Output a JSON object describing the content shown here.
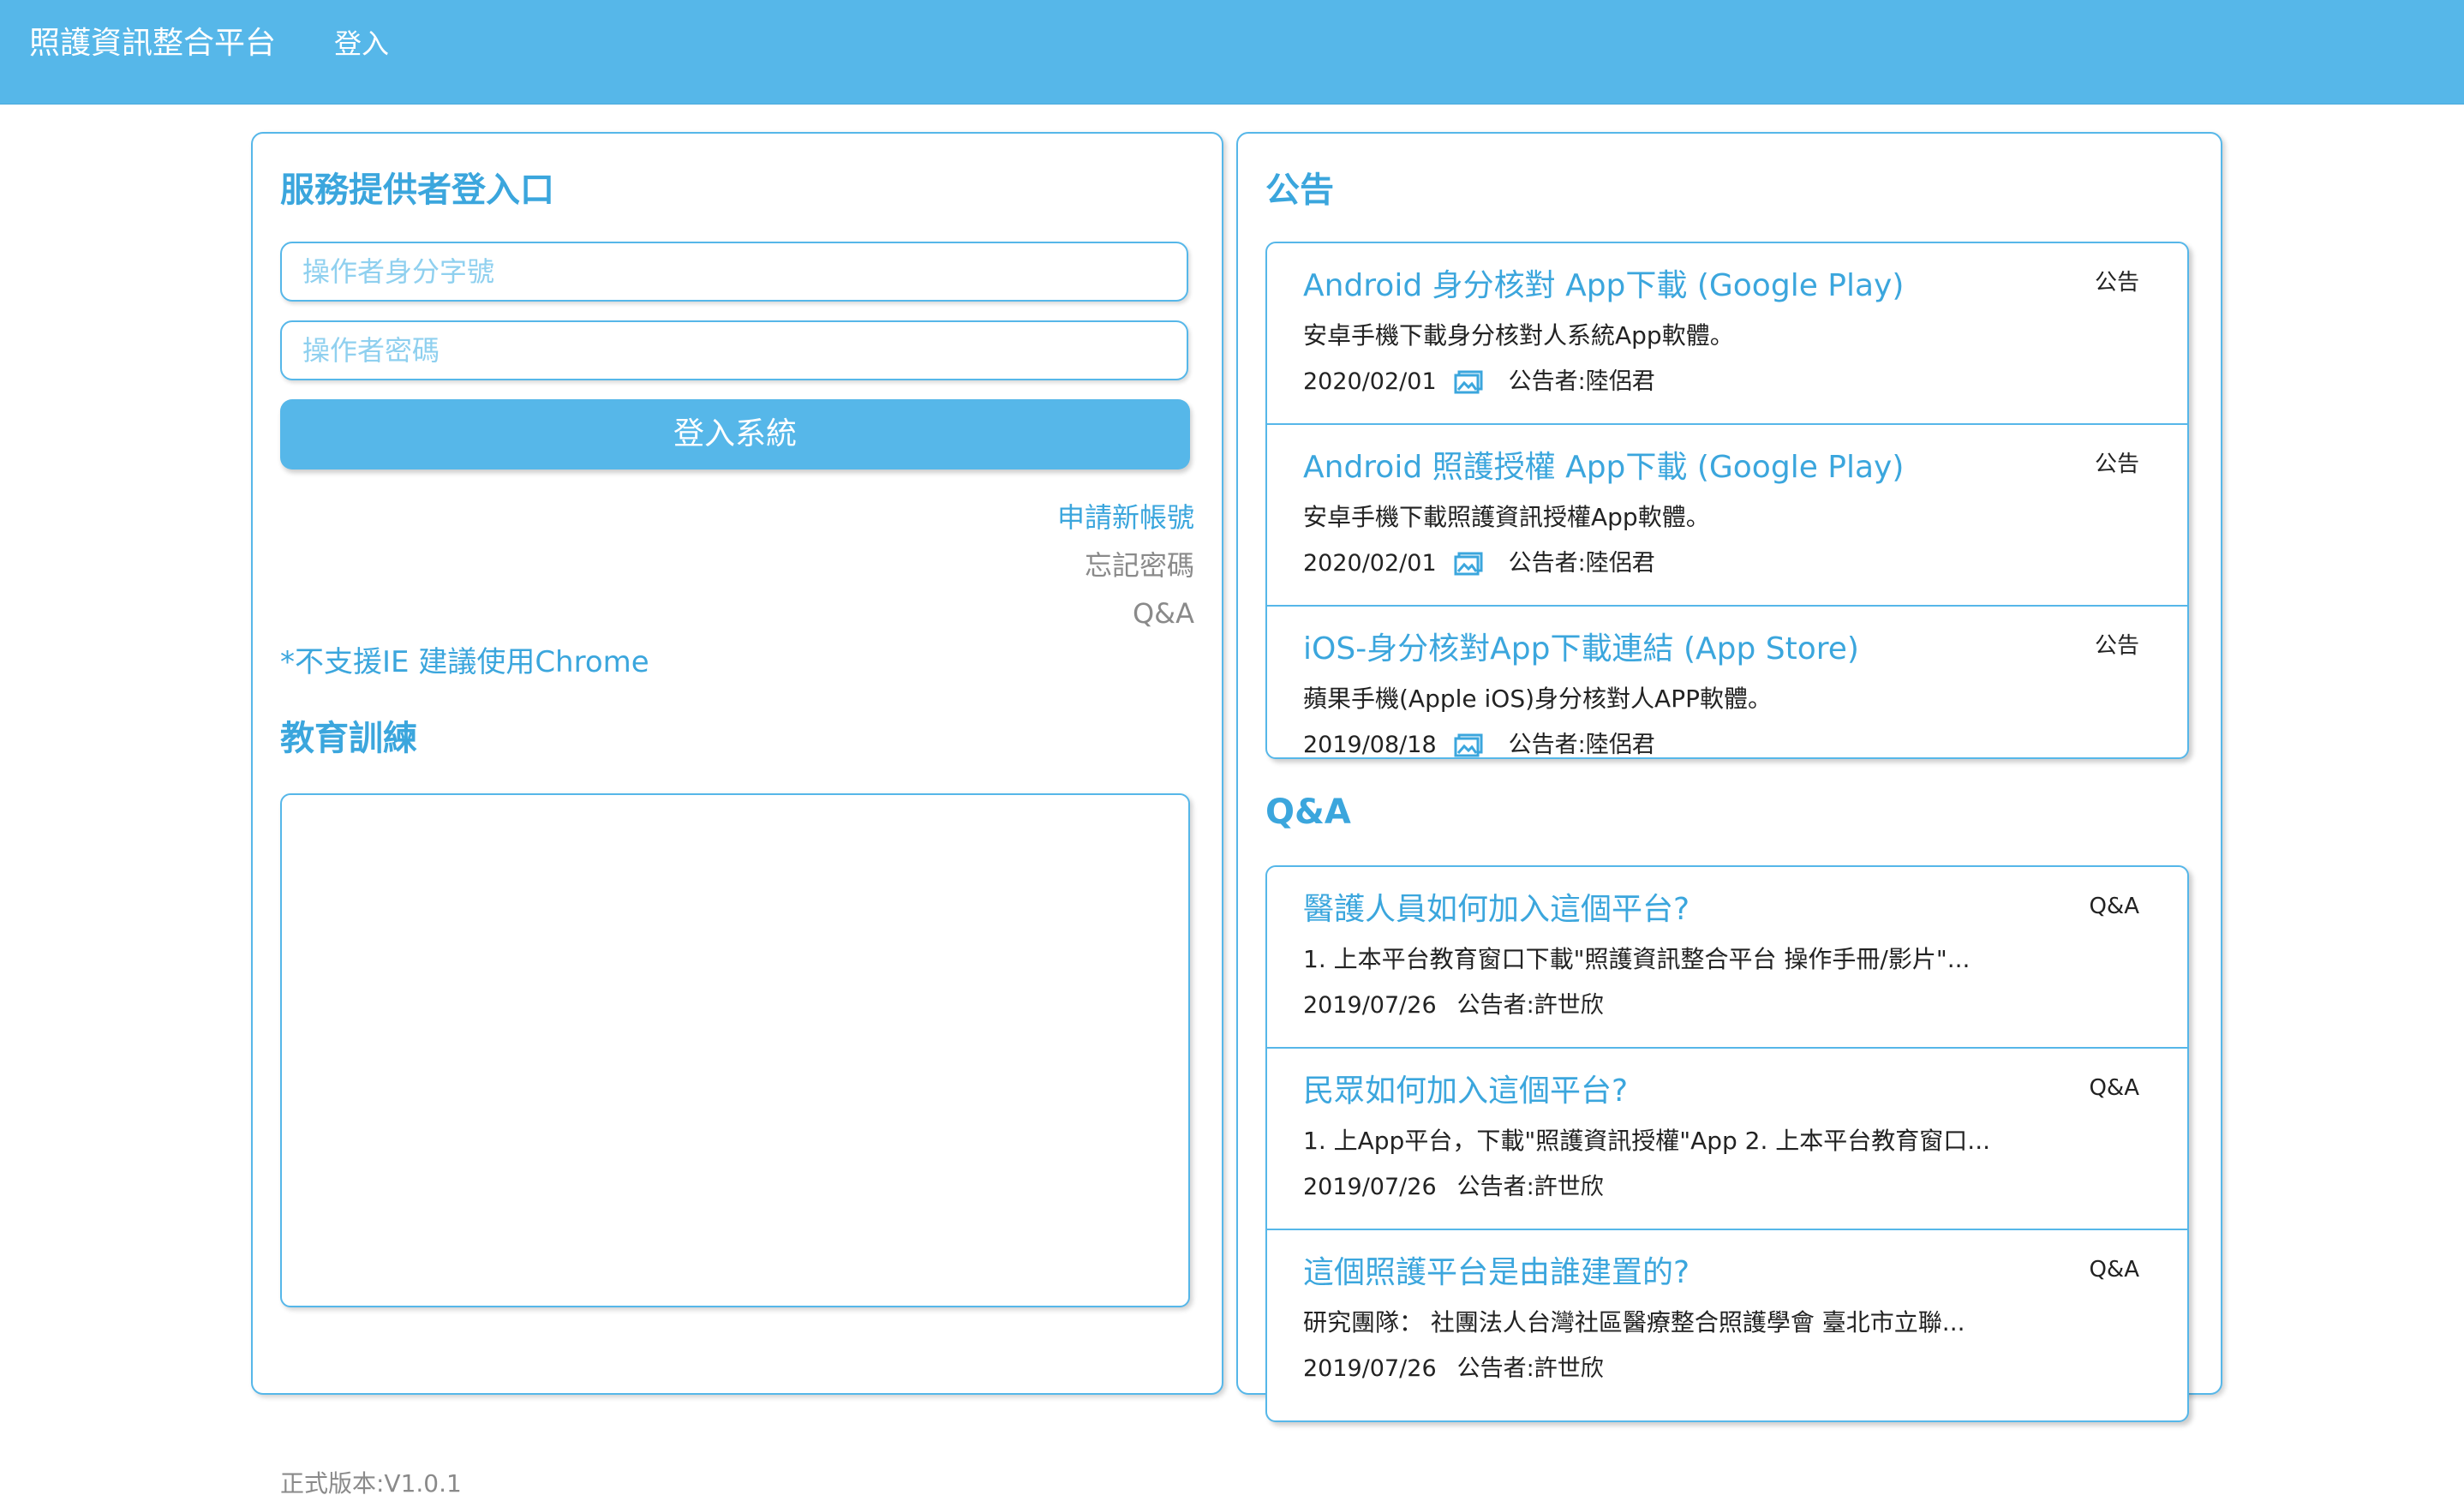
{
  "navbar": {
    "brand": "照護資訊整合平台",
    "login": "登入"
  },
  "login_panel": {
    "title": "服務提供者登入口",
    "id_placeholder": "操作者身分字號",
    "password_placeholder": "操作者密碼",
    "submit_label": "登入系統",
    "register_link": "申請新帳號",
    "forgot_link": "忘記密碼",
    "qa_link": "Q&A",
    "ie_note": "*不支援IE 建議使用Chrome",
    "education_title": "教育訓練",
    "version": "正式版本:V1.0.1"
  },
  "announcements": {
    "title": "公告",
    "items": [
      {
        "title": "Android 身分核對 App下載 (Google Play)",
        "tag": "公告",
        "desc": "安卓手機下載身分核對人系統App軟體。",
        "date": "2020/02/01",
        "author": "公告者:陸侶君"
      },
      {
        "title": "Android 照護授權 App下載 (Google Play)",
        "tag": "公告",
        "desc": "安卓手機下載照護資訊授權App軟體。",
        "date": "2020/02/01",
        "author": "公告者:陸侶君"
      },
      {
        "title": "iOS-身分核對App下載連結 (App Store)",
        "tag": "公告",
        "desc": "蘋果手機(Apple iOS)身分核對人APP軟體。",
        "date": "2019/08/18",
        "author": "公告者:陸侶君"
      }
    ]
  },
  "qa": {
    "title": "Q&A",
    "items": [
      {
        "title": "醫護人員如何加入這個平台?",
        "tag": "Q&A",
        "desc": "1. 上本平台教育窗口下載\"照護資訊整合平台 操作手冊/影片\"...",
        "date": "2019/07/26",
        "author": "公告者:許世欣"
      },
      {
        "title": "民眾如何加入這個平台?",
        "tag": "Q&A",
        "desc": "1. 上App平台，下載\"照護資訊授權\"App 2. 上本平台教育窗口...",
        "date": "2019/07/26",
        "author": "公告者:許世欣"
      },
      {
        "title": "這個照護平台是由誰建置的?",
        "tag": "Q&A",
        "desc": "研究團隊： 社團法人台灣社區醫療整合照護學會 臺北市立聯...",
        "date": "2019/07/26",
        "author": "公告者:許世欣"
      }
    ]
  },
  "colors": {
    "accent": "#56b7e9",
    "heading": "#3ba6dd"
  }
}
